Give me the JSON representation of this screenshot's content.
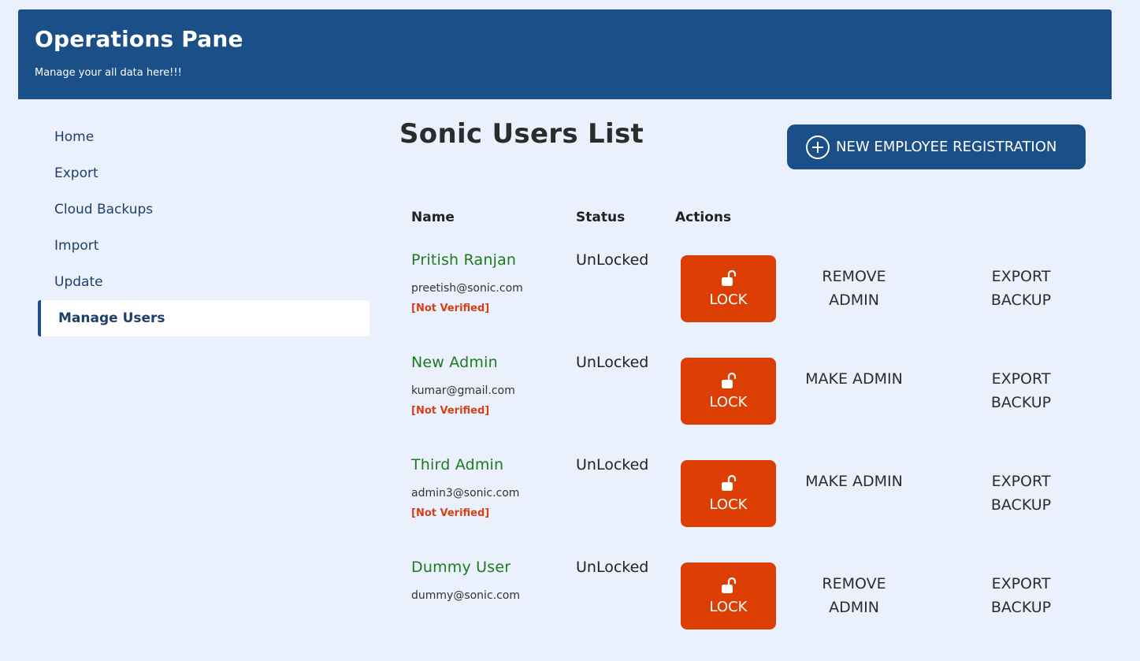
{
  "header": {
    "title": "Operations Pane",
    "subtitle": "Manage your all data here!!!"
  },
  "sidebar": {
    "items": [
      {
        "label": "Home"
      },
      {
        "label": "Export"
      },
      {
        "label": "Cloud Backups"
      },
      {
        "label": "Import"
      },
      {
        "label": "Update"
      },
      {
        "label": "Manage Users",
        "active": true
      }
    ]
  },
  "main": {
    "title": "Sonic Users List",
    "new_button_label": "NEW EMPLOYEE REGISTRATION",
    "columns": {
      "name": "Name",
      "status": "Status",
      "actions": "Actions"
    },
    "users": [
      {
        "name": "Pritish Ranjan",
        "email": "preetish@sonic.com",
        "verification": "[Not Verified]",
        "status": "UnLocked",
        "lock_label": "LOCK",
        "admin_action": "REMOVE ADMIN",
        "export_action": "EXPORT BACKUP"
      },
      {
        "name": "New Admin",
        "email": "kumar@gmail.com",
        "verification": "[Not Verified]",
        "status": "UnLocked",
        "lock_label": "LOCK",
        "admin_action": "MAKE ADMIN",
        "export_action": "EXPORT BACKUP"
      },
      {
        "name": "Third Admin",
        "email": "admin3@sonic.com",
        "verification": "[Not Verified]",
        "status": "UnLocked",
        "lock_label": "LOCK",
        "admin_action": "MAKE ADMIN",
        "export_action": "EXPORT BACKUP"
      },
      {
        "name": "Dummy User",
        "email": "dummy@sonic.com",
        "verification": "",
        "status": "UnLocked",
        "lock_label": "LOCK",
        "admin_action": "REMOVE ADMIN",
        "export_action": "EXPORT BACKUP"
      }
    ]
  },
  "icons": {
    "new_button": "plus-circle-icon",
    "lock_button": "unlock-icon"
  },
  "colors": {
    "header_bg": "#1b4f87",
    "page_bg": "#eaf1fc",
    "lock_button_bg": "#dc3e04",
    "user_name": "#1d7a1d",
    "not_verified": "#d64016"
  }
}
